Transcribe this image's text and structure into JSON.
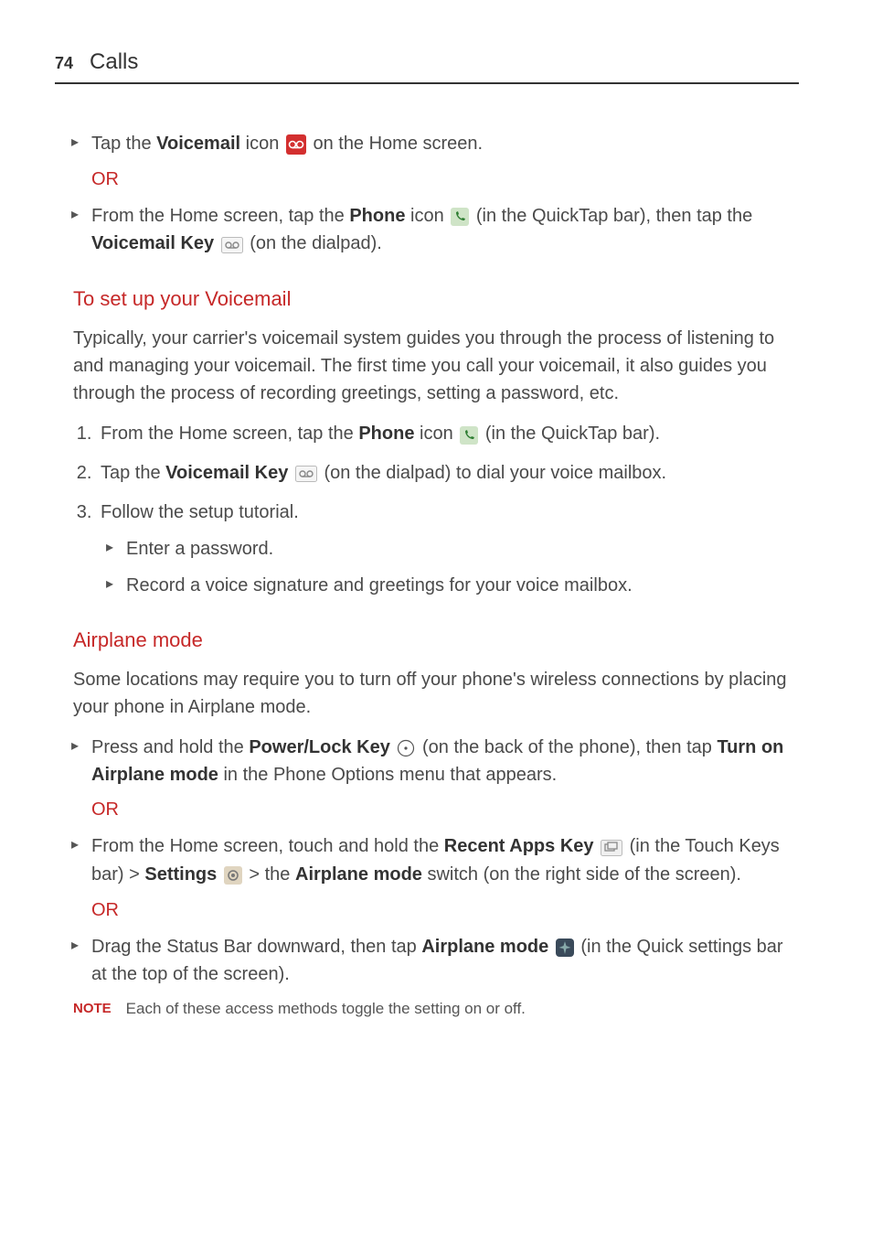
{
  "page_number": "74",
  "section_title": "Calls",
  "voicemail_access": {
    "item1_pre": "Tap the ",
    "item1_bold": "Voicemail",
    "item1_mid": " icon ",
    "item1_post": " on the Home screen.",
    "or": "OR",
    "item2_pre": "From the Home screen, tap the ",
    "item2_bold1": "Phone",
    "item2_mid1": " icon ",
    "item2_mid2": " (in the QuickTap bar), then tap the ",
    "item2_bold2": "Voicemail Key",
    "item2_post": " (on the dialpad)."
  },
  "setup_heading": "To set up your Voicemail",
  "setup_para": "Typically, your carrier's voicemail system guides you through the process of listening to and managing your voicemail. The first time you call your voicemail, it also guides you through the process of recording greetings, setting a password, etc.",
  "setup_steps": {
    "s1_pre": "From the Home screen, tap the ",
    "s1_bold": "Phone",
    "s1_mid": " icon ",
    "s1_post": " (in the QuickTap bar).",
    "s2_pre": "Tap the ",
    "s2_bold": "Voicemail Key",
    "s2_post": " (on the dialpad) to dial your voice mailbox.",
    "s3": "Follow the setup tutorial.",
    "s3a": "Enter a password.",
    "s3b": "Record a voice signature and greetings for your voice mailbox."
  },
  "airplane_heading": "Airplane mode",
  "airplane_para": "Some locations may require you to turn off your phone's wireless connections by placing your phone in Airplane mode.",
  "airplane_methods": {
    "m1_pre": "Press and hold the ",
    "m1_bold1": "Power/Lock Key",
    "m1_mid1": " (on the back of the phone), then tap ",
    "m1_bold2": "Turn on Airplane mode",
    "m1_post": " in the Phone Options menu that appears.",
    "or": "OR",
    "m2_pre": "From the Home screen, touch and hold the ",
    "m2_bold1": "Recent Apps Key",
    "m2_mid1": " (in the Touch Keys bar) > ",
    "m2_bold2": "Settings",
    "m2_mid2": " > the ",
    "m2_bold3": "Airplane mode",
    "m2_post": " switch (on the right side of the screen).",
    "m3_pre": "Drag the Status Bar downward, then tap ",
    "m3_bold": "Airplane mode",
    "m3_post": " (in the Quick settings bar at the top of the screen)."
  },
  "note_label": "NOTE",
  "note_text": "Each of these access methods toggle the setting on or off."
}
